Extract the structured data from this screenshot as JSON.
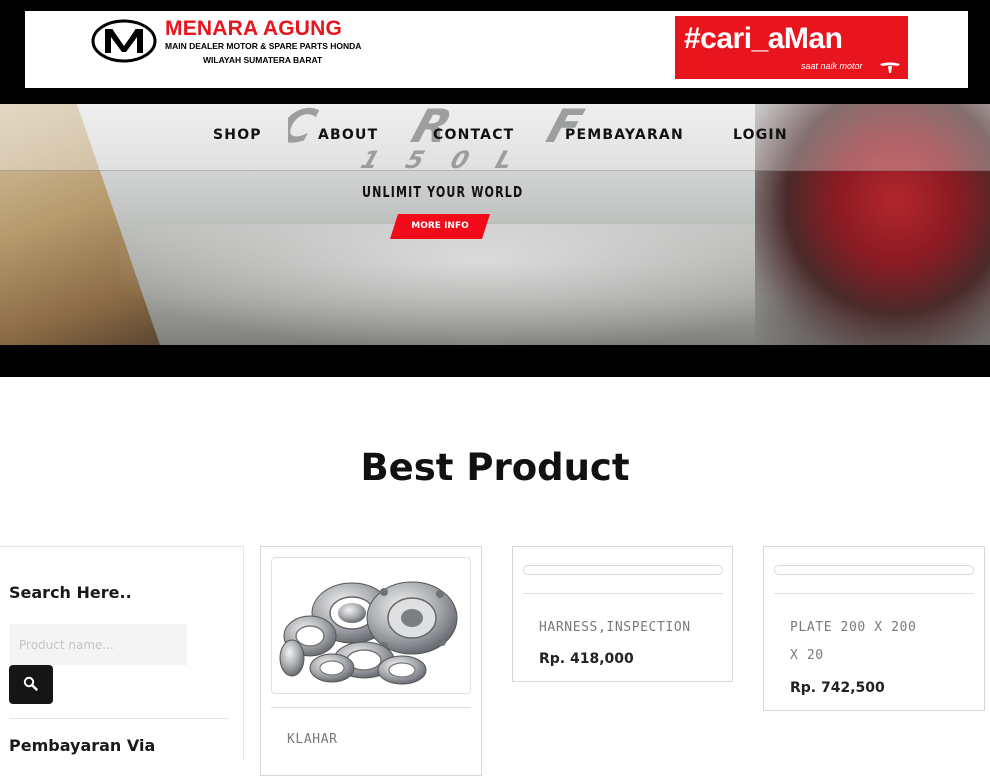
{
  "header": {
    "logo": {
      "name": "MENARA AGUNG",
      "subtitle_line1": "MAIN DEALER MOTOR & SPARE PARTS HONDA",
      "subtitle_line2": "WILAYAH SUMATERA BARAT"
    },
    "campaign": {
      "tag": "#cari_aMan",
      "subtitle": "saat naik motor"
    }
  },
  "nav": {
    "items": [
      "SHOP",
      "ABOUT",
      "CONTACT",
      "PEMBAYARAN",
      "LOGIN"
    ]
  },
  "hero": {
    "model": "CRF",
    "variant": "150L",
    "tagline": "UNLIMIT YOUR WORLD",
    "cta_label": "MORE INFO"
  },
  "main": {
    "section_title": "Best Product"
  },
  "sidebar": {
    "search_heading": "Search Here..",
    "search_placeholder": "Product name...",
    "search_value": "",
    "payment_heading": "Pembayaran Via"
  },
  "products": [
    {
      "name": "KLAHAR",
      "price": "",
      "has_image": true
    },
    {
      "name": "HARNESS,INSPECTION",
      "price": "Rp. 418,000",
      "has_image": false
    },
    {
      "name": "PLATE 200 X 200 X 20",
      "price": "Rp. 742,500",
      "has_image": false
    }
  ],
  "colors": {
    "brand_red": "#e8141e",
    "cta_red": "#f20a1a",
    "header_black": "#000000"
  },
  "icons": {
    "search": "magnifier-icon",
    "logo_emblem": "m-emblem-icon",
    "honda_wing": "honda-wing-icon"
  }
}
